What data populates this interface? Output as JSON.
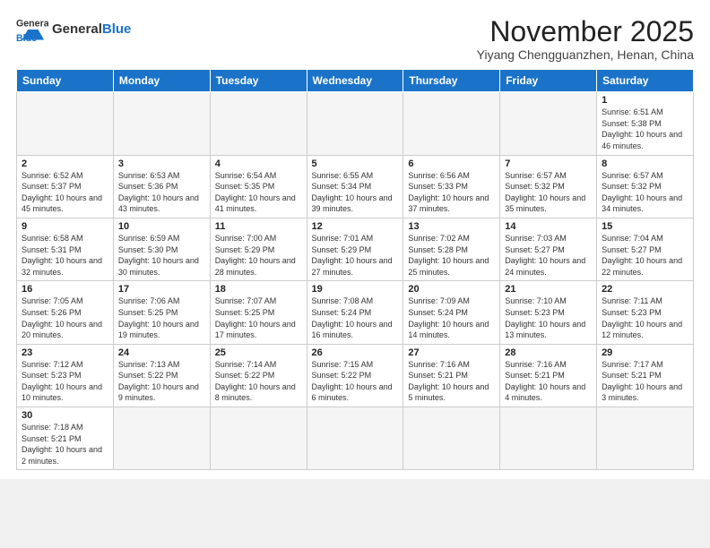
{
  "header": {
    "logo_general": "General",
    "logo_blue": "Blue",
    "month_title": "November 2025",
    "location": "Yiyang Chengguanzhen, Henan, China"
  },
  "weekdays": [
    "Sunday",
    "Monday",
    "Tuesday",
    "Wednesday",
    "Thursday",
    "Friday",
    "Saturday"
  ],
  "weeks": [
    [
      {
        "num": "",
        "info": ""
      },
      {
        "num": "",
        "info": ""
      },
      {
        "num": "",
        "info": ""
      },
      {
        "num": "",
        "info": ""
      },
      {
        "num": "",
        "info": ""
      },
      {
        "num": "",
        "info": ""
      },
      {
        "num": "1",
        "info": "Sunrise: 6:51 AM\nSunset: 5:38 PM\nDaylight: 10 hours and 46 minutes."
      }
    ],
    [
      {
        "num": "2",
        "info": "Sunrise: 6:52 AM\nSunset: 5:37 PM\nDaylight: 10 hours and 45 minutes."
      },
      {
        "num": "3",
        "info": "Sunrise: 6:53 AM\nSunset: 5:36 PM\nDaylight: 10 hours and 43 minutes."
      },
      {
        "num": "4",
        "info": "Sunrise: 6:54 AM\nSunset: 5:35 PM\nDaylight: 10 hours and 41 minutes."
      },
      {
        "num": "5",
        "info": "Sunrise: 6:55 AM\nSunset: 5:34 PM\nDaylight: 10 hours and 39 minutes."
      },
      {
        "num": "6",
        "info": "Sunrise: 6:56 AM\nSunset: 5:33 PM\nDaylight: 10 hours and 37 minutes."
      },
      {
        "num": "7",
        "info": "Sunrise: 6:57 AM\nSunset: 5:32 PM\nDaylight: 10 hours and 35 minutes."
      },
      {
        "num": "8",
        "info": "Sunrise: 6:57 AM\nSunset: 5:32 PM\nDaylight: 10 hours and 34 minutes."
      }
    ],
    [
      {
        "num": "9",
        "info": "Sunrise: 6:58 AM\nSunset: 5:31 PM\nDaylight: 10 hours and 32 minutes."
      },
      {
        "num": "10",
        "info": "Sunrise: 6:59 AM\nSunset: 5:30 PM\nDaylight: 10 hours and 30 minutes."
      },
      {
        "num": "11",
        "info": "Sunrise: 7:00 AM\nSunset: 5:29 PM\nDaylight: 10 hours and 28 minutes."
      },
      {
        "num": "12",
        "info": "Sunrise: 7:01 AM\nSunset: 5:29 PM\nDaylight: 10 hours and 27 minutes."
      },
      {
        "num": "13",
        "info": "Sunrise: 7:02 AM\nSunset: 5:28 PM\nDaylight: 10 hours and 25 minutes."
      },
      {
        "num": "14",
        "info": "Sunrise: 7:03 AM\nSunset: 5:27 PM\nDaylight: 10 hours and 24 minutes."
      },
      {
        "num": "15",
        "info": "Sunrise: 7:04 AM\nSunset: 5:27 PM\nDaylight: 10 hours and 22 minutes."
      }
    ],
    [
      {
        "num": "16",
        "info": "Sunrise: 7:05 AM\nSunset: 5:26 PM\nDaylight: 10 hours and 20 minutes."
      },
      {
        "num": "17",
        "info": "Sunrise: 7:06 AM\nSunset: 5:25 PM\nDaylight: 10 hours and 19 minutes."
      },
      {
        "num": "18",
        "info": "Sunrise: 7:07 AM\nSunset: 5:25 PM\nDaylight: 10 hours and 17 minutes."
      },
      {
        "num": "19",
        "info": "Sunrise: 7:08 AM\nSunset: 5:24 PM\nDaylight: 10 hours and 16 minutes."
      },
      {
        "num": "20",
        "info": "Sunrise: 7:09 AM\nSunset: 5:24 PM\nDaylight: 10 hours and 14 minutes."
      },
      {
        "num": "21",
        "info": "Sunrise: 7:10 AM\nSunset: 5:23 PM\nDaylight: 10 hours and 13 minutes."
      },
      {
        "num": "22",
        "info": "Sunrise: 7:11 AM\nSunset: 5:23 PM\nDaylight: 10 hours and 12 minutes."
      }
    ],
    [
      {
        "num": "23",
        "info": "Sunrise: 7:12 AM\nSunset: 5:23 PM\nDaylight: 10 hours and 10 minutes."
      },
      {
        "num": "24",
        "info": "Sunrise: 7:13 AM\nSunset: 5:22 PM\nDaylight: 10 hours and 9 minutes."
      },
      {
        "num": "25",
        "info": "Sunrise: 7:14 AM\nSunset: 5:22 PM\nDaylight: 10 hours and 8 minutes."
      },
      {
        "num": "26",
        "info": "Sunrise: 7:15 AM\nSunset: 5:22 PM\nDaylight: 10 hours and 6 minutes."
      },
      {
        "num": "27",
        "info": "Sunrise: 7:16 AM\nSunset: 5:21 PM\nDaylight: 10 hours and 5 minutes."
      },
      {
        "num": "28",
        "info": "Sunrise: 7:16 AM\nSunset: 5:21 PM\nDaylight: 10 hours and 4 minutes."
      },
      {
        "num": "29",
        "info": "Sunrise: 7:17 AM\nSunset: 5:21 PM\nDaylight: 10 hours and 3 minutes."
      }
    ],
    [
      {
        "num": "30",
        "info": "Sunrise: 7:18 AM\nSunset: 5:21 PM\nDaylight: 10 hours and 2 minutes."
      },
      {
        "num": "",
        "info": ""
      },
      {
        "num": "",
        "info": ""
      },
      {
        "num": "",
        "info": ""
      },
      {
        "num": "",
        "info": ""
      },
      {
        "num": "",
        "info": ""
      },
      {
        "num": "",
        "info": ""
      }
    ]
  ]
}
